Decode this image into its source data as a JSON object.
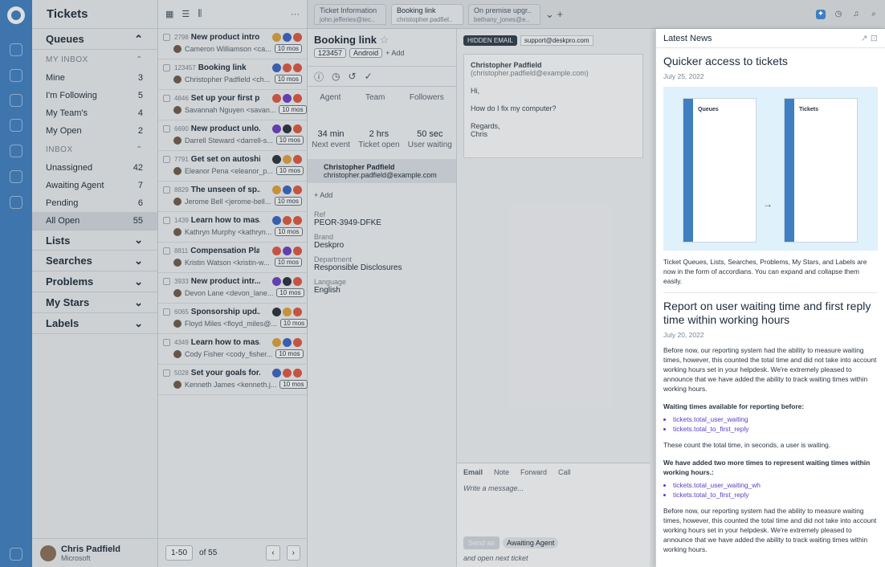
{
  "app": {
    "title": "Tickets"
  },
  "queues": {
    "header": "Queues",
    "my_inbox_label": "MY INBOX",
    "my_inbox": [
      {
        "label": "Mine",
        "count": "3"
      },
      {
        "label": "I'm Following",
        "count": "5"
      },
      {
        "label": "My Team's",
        "count": "4"
      },
      {
        "label": "My Open",
        "count": "2"
      }
    ],
    "inbox_label": "INBOX",
    "inbox": [
      {
        "label": "Unassigned",
        "count": "42"
      },
      {
        "label": "Awaiting Agent",
        "count": "7"
      },
      {
        "label": "Pending",
        "count": "6"
      },
      {
        "label": "All Open",
        "count": "55"
      }
    ],
    "sections": [
      "Lists",
      "Searches",
      "Problems",
      "My Stars",
      "Labels"
    ]
  },
  "user": {
    "name": "Chris Padfield",
    "org": "Microsoft"
  },
  "tickets": [
    {
      "id": "2798",
      "subject": "New product intro...",
      "person": "Cameron Williamson <ca...",
      "age": "10 mos"
    },
    {
      "id": "123457",
      "subject": "Booking link",
      "person": "Christopher Padfield <ch...",
      "age": "10 mos",
      "num": "1"
    },
    {
      "id": "4846",
      "subject": "Set up your first p...",
      "person": "Savannah Nguyen <savan...",
      "age": "10 mos"
    },
    {
      "id": "6690",
      "subject": "New product unlo...",
      "person": "Darrell Steward <darrell-s...",
      "age": "10 mos"
    },
    {
      "id": "7791",
      "subject": "Get set on autoship",
      "person": "Eleanor Pena <eleanor_p...",
      "age": "10 mos"
    },
    {
      "id": "8829",
      "subject": "The unseen of sp...",
      "person": "Jerome Bell <jerome-bell...",
      "age": "10 mos"
    },
    {
      "id": "1439",
      "subject": "Learn how to mas...",
      "person": "Kathryn Murphy <kathryn...",
      "age": "10 mos"
    },
    {
      "id": "8811",
      "subject": "Compensation Plan",
      "person": "Kristin Watson <kristin-w...",
      "age": "10 mos"
    },
    {
      "id": "3933",
      "subject": "New product intr...",
      "person": "Devon Lane <devon_lane...",
      "age": "10 mos"
    },
    {
      "id": "6065",
      "subject": "Sponsorship upd...",
      "person": "Floyd Miles <floyd_miles@...",
      "age": "10 mos"
    },
    {
      "id": "4349",
      "subject": "Learn how to mas...",
      "person": "Cody Fisher <cody_fisher...",
      "age": "10 mos"
    },
    {
      "id": "5028",
      "subject": "Set your goals for...",
      "person": "Kenneth James <kenneth.j...",
      "age": "10 mos"
    }
  ],
  "pagination": {
    "range": "1-50",
    "of": "of 55"
  },
  "tabs": [
    {
      "title": "Ticket Information",
      "sub": "john.jefferies@tec.."
    },
    {
      "title": "Booking link",
      "sub": "christopher.padfiel.."
    },
    {
      "title": "On premise upgr..",
      "sub": "bethany_jones@e.."
    }
  ],
  "ticket": {
    "title": "Booking link",
    "id_chip": "123457",
    "label_chip": "Android",
    "add": "+ Add",
    "roles": [
      "Agent",
      "Team",
      "Followers"
    ],
    "stats": [
      {
        "value": "34 min",
        "label": "Next event"
      },
      {
        "value": "2 hrs",
        "label": "Ticket open"
      },
      {
        "value": "50 sec",
        "label": "User waiting"
      }
    ],
    "contact_name": "Christopher Padfield",
    "contact_email": "christopher.padfield@example.com",
    "fields": [
      {
        "label": "Ref",
        "value": "PEOR-3949-DFKE"
      },
      {
        "label": "Brand",
        "value": "Deskpro"
      },
      {
        "label": "Department",
        "value": "Responsible Disclosures"
      },
      {
        "label": "Language",
        "value": "English"
      }
    ]
  },
  "conversation": {
    "hidden_label": "HIDDEN EMAIL",
    "hidden_addr": "support@deskpro.com",
    "from": "Christopher Padfield",
    "from_email": "(christopher.padfield@example.com)",
    "body": [
      "Hi,",
      "How do I fix my computer?",
      "Regards,",
      "Chris"
    ],
    "reply_tabs": [
      "Email",
      "Note",
      "Forward",
      "Call"
    ],
    "placeholder": "Write a message...",
    "send_as": "Send as",
    "status": "Awaiting Agent",
    "next": "and open next ticket",
    "agent": "Agent",
    "team": "Team"
  },
  "news": {
    "header": "Latest News",
    "a1": {
      "title": "Quicker access to tickets",
      "date": "July 25, 2022",
      "body": "Ticket Queues, Lists, Searches, Problems, My Stars, and Labels are now in the form of accordians. You can expand and collapse them easily.",
      "pv_left": "Queues",
      "pv_right": "Tickets"
    },
    "a2": {
      "title": "Report on user waiting time and first reply time within working hours",
      "date": "July 20, 2022",
      "p1": "Before now, our reporting system had the ability to measure waiting times, however, this counted the total time and did not take into account working hours set in your helpdesk. We're extremely pleased to announce that we have added the ability to track waiting times within working hours.",
      "h1": "Waiting times available for reporting before:",
      "l1": [
        "tickets.total_user_waiting",
        "tickets.total_to_first_reply"
      ],
      "p2": "These count the total time, in seconds, a user is waiting.",
      "h2": "We have added two more times to represent waiting times within working hours.:",
      "l2": [
        "tickets.total_user_waiting_wh",
        "tickets.total_to_first_reply"
      ],
      "p3": "Before now, our reporting system had the ability to measure waiting times, however, this counted the total time and did not take into account working hours set in your helpdesk. We're extremely pleased to announce that we have added the ability to track waiting times within working hours."
    }
  },
  "colors": {
    "rail": "#3f7fc1",
    "accent": "#5b3cc4"
  }
}
